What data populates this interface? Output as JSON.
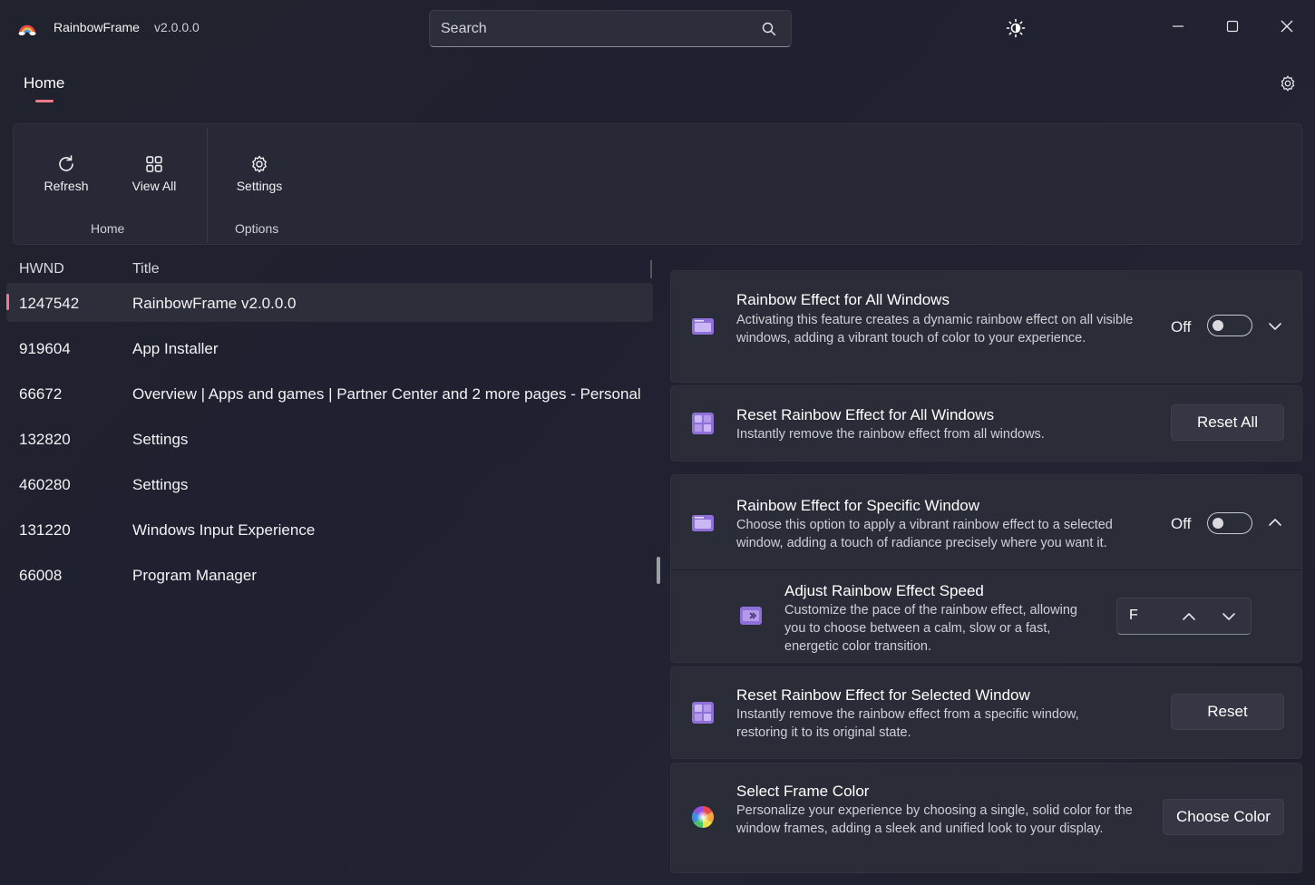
{
  "titlebar": {
    "app_name": "RainbowFrame",
    "version": "v2.0.0.0",
    "search_placeholder": "Search"
  },
  "nav": {
    "home_label": "Home"
  },
  "ribbon": {
    "refresh_label": "Refresh",
    "view_all_label": "View All",
    "settings_label": "Settings",
    "group_home_label": "Home",
    "group_options_label": "Options"
  },
  "window_list": {
    "columns": [
      "HWND",
      "Title"
    ],
    "rows": [
      {
        "hwnd": "1247542",
        "title": "RainbowFrame v2.0.0.0",
        "selected": true
      },
      {
        "hwnd": "919604",
        "title": "App Installer"
      },
      {
        "hwnd": "66672",
        "title": "Overview | Apps and games | Partner Center and 2 more pages - Personal"
      },
      {
        "hwnd": "132820",
        "title": "Settings"
      },
      {
        "hwnd": "460280",
        "title": "Settings"
      },
      {
        "hwnd": "131220",
        "title": "Windows Input Experience"
      },
      {
        "hwnd": "66008",
        "title": "Program Manager"
      }
    ]
  },
  "cards": {
    "all_windows": {
      "title": "Rainbow Effect for All Windows",
      "description": "Activating this feature creates a dynamic rainbow effect on all visible windows, adding a vibrant touch of color to your experience.",
      "toggle_label": "Off"
    },
    "reset_all": {
      "title": "Reset Rainbow Effect for All Windows",
      "description": "Instantly remove the rainbow effect from all windows.",
      "button_label": "Reset All"
    },
    "specific_window": {
      "title": "Rainbow Effect for Specific Window",
      "description": "Choose this option to apply a vibrant rainbow effect to a selected window, adding a touch of radiance precisely where you want it.",
      "toggle_label": "Off"
    },
    "speed": {
      "title": "Adjust Rainbow Effect Speed",
      "description": "Customize the pace of the rainbow effect, allowing you to choose between a calm, slow or a fast, energetic color transition.",
      "value": "F"
    },
    "reset_selected": {
      "title": "Reset Rainbow Effect for Selected Window",
      "description": "Instantly remove the rainbow effect from a specific window, restoring it to its original state.",
      "button_label": "Reset"
    },
    "frame_color": {
      "title": "Select Frame Color",
      "description": "Personalize your experience by choosing a single, solid color for the window frames, adding a sleek and unified look to your display.",
      "button_label": "Choose Color"
    }
  },
  "colors": {
    "accent": "#f07a8c",
    "icon_purple": "#8f6fd8",
    "background": "#20222e",
    "card": "#2a2c38"
  }
}
